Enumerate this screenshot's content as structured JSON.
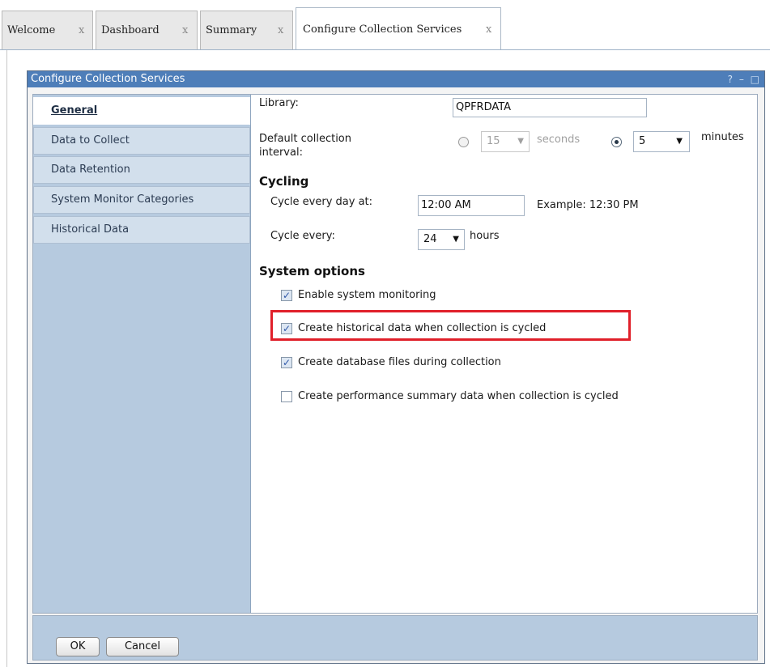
{
  "tabs": [
    {
      "label": "Welcome",
      "close": "x"
    },
    {
      "label": "Dashboard",
      "close": "x"
    },
    {
      "label": "Summary",
      "close": "x"
    },
    {
      "label": "Configure Collection Services",
      "close": "x",
      "active": true
    }
  ],
  "dialog": {
    "title": "Configure Collection Services",
    "controls": "? – □"
  },
  "nav": {
    "items": [
      {
        "label": "General",
        "selected": true
      },
      {
        "label": "Data to Collect"
      },
      {
        "label": "Data Retention"
      },
      {
        "label": "System Monitor Categories"
      },
      {
        "label": "Historical Data"
      }
    ]
  },
  "general": {
    "library_label": "Library:",
    "library_value": "QPFRDATA",
    "interval_label": "Default collection interval:",
    "seconds_value": "15",
    "seconds_label": "seconds",
    "seconds_selected": false,
    "minutes_value": "5",
    "minutes_label": "minutes",
    "minutes_selected": true
  },
  "cycling": {
    "heading": "Cycling",
    "cycle_day_label": "Cycle every day at:",
    "cycle_day_value": "12:00 AM",
    "example": "Example: 12:30 PM",
    "cycle_every_label": "Cycle every:",
    "cycle_every_value": "24",
    "hours_label": "hours"
  },
  "system_options": {
    "heading": "System options",
    "options": [
      {
        "label": "Enable system monitoring",
        "checked": true
      },
      {
        "label": "Create historical data when collection is cycled",
        "checked": true
      },
      {
        "label": "Create database files during collection",
        "checked": true
      },
      {
        "label": "Create performance summary data when collection is cycled",
        "checked": false
      }
    ]
  },
  "footer": {
    "ok_label": "OK",
    "cancel_label": "Cancel"
  },
  "colors": {
    "titlebar": "#4e7eb9",
    "nav_bg": "#b6cadf",
    "highlight": "#e0202a"
  }
}
